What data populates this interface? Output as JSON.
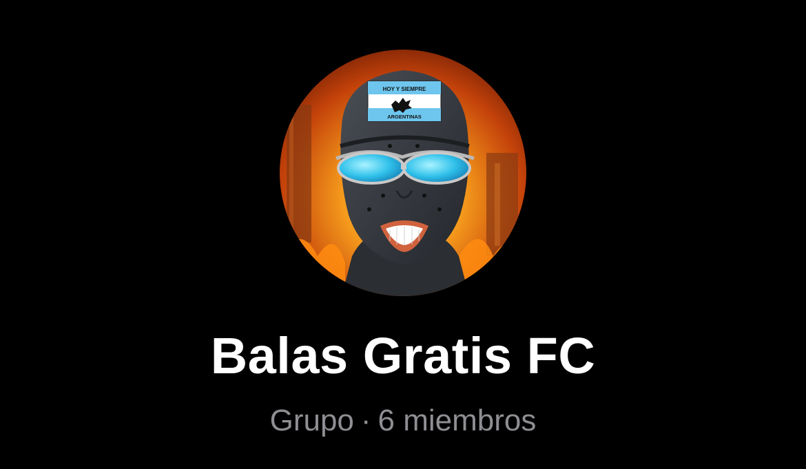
{
  "group": {
    "name": "Balas Gratis FC",
    "type_label": "Grupo",
    "separator": "·",
    "members_label": "6 miembros"
  },
  "avatar": {
    "alt": "group-photo",
    "cap_text_top": "HOY Y SIEMPRE",
    "cap_text_bottom": "ARGENTINAS"
  },
  "colors": {
    "background": "#000000",
    "title": "#ffffff",
    "subtitle": "#8e8e93"
  }
}
